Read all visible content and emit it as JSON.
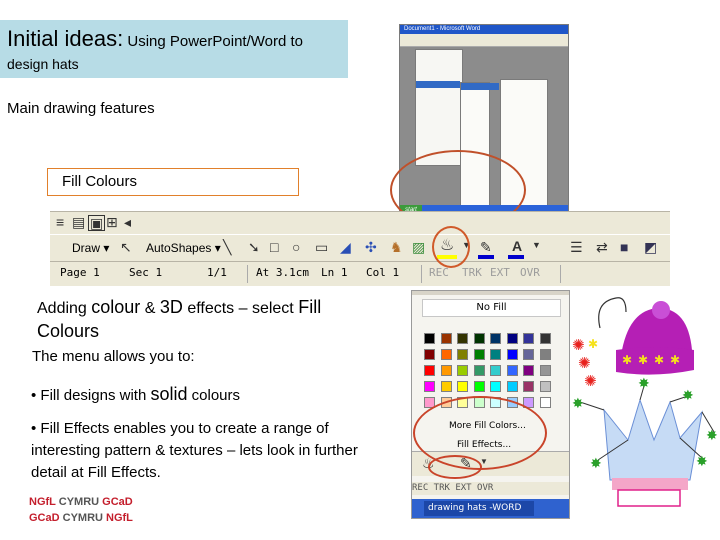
{
  "title": {
    "main": "Initial ideas:",
    "rest": " Using PowerPoint/Word to",
    "line2": "design hats"
  },
  "drawing_features": "Main drawing features",
  "fill_colours_label": "Fill Colours",
  "menu_screenshot": {
    "title": "Document1 - Microsoft Word",
    "start": "start"
  },
  "toolbar": {
    "draw": "Draw ▾",
    "autoshapes": "AutoShapes ▾",
    "status": {
      "page": "Page 1",
      "sec": "Sec 1",
      "pages": "1/1",
      "at": "At 3.1cm",
      "ln": "Ln 1",
      "col": "Col 1",
      "rec": "REC",
      "trk": "TRK",
      "ext": "EXT",
      "ovr": "OVR"
    }
  },
  "text": {
    "adding_pre": "Adding ",
    "adding_colour": "colour",
    "adding_mid": " & ",
    "adding_3d": "3D",
    "adding_post": " effects – select ",
    "adding_fill": "Fill",
    "adding_colours": "Colours",
    "allows": "The menu allows you to:",
    "bullet1_pre": "• Fill designs with ",
    "bullet1_solid": "solid",
    "bullet1_post": " colours",
    "bullet2": "• Fill Effects enables you to create a range of interesting pattern & textures – lets look in further detail at Fill Effects."
  },
  "logos": {
    "line1_a": "NGfL",
    "line1_b": " CYMRU ",
    "line1_c": "GCaD",
    "line2_a": "GCaD",
    "line2_b": " CYMRU ",
    "line2_c": "NGfL"
  },
  "palette": {
    "no_fill": "No Fill",
    "more_fill": "More Fill Colors...",
    "fill_effects": "Fill Effects...",
    "status": "REC  TRK  EXT  OVR",
    "task": "drawing hats -WORD",
    "swatch_rows": [
      [
        "#000000",
        "#993300",
        "#333300",
        "#003300",
        "#003366",
        "#000080",
        "#333399",
        "#333333"
      ],
      [
        "#800000",
        "#ff6600",
        "#808000",
        "#008000",
        "#008080",
        "#0000ff",
        "#666699",
        "#808080"
      ],
      [
        "#ff0000",
        "#ff9900",
        "#99cc00",
        "#339966",
        "#33cccc",
        "#3366ff",
        "#800080",
        "#969696"
      ],
      [
        "#ff00ff",
        "#ffcc00",
        "#ffff00",
        "#00ff00",
        "#00ffff",
        "#00ccff",
        "#993366",
        "#c0c0c0"
      ],
      [
        "#ff99cc",
        "#ffcc99",
        "#ffff99",
        "#ccffcc",
        "#ccffff",
        "#99ccff",
        "#cc99ff",
        "#ffffff"
      ]
    ]
  },
  "colors": {
    "title_bg": "#b7dce6",
    "oval": "#c9442a",
    "hat_purple": "#b51fb5",
    "star_red": "#e8201c",
    "star_yellow": "#f6e21c"
  }
}
